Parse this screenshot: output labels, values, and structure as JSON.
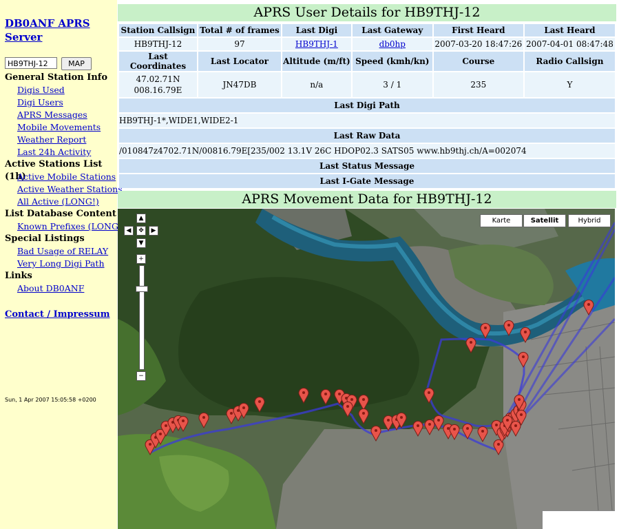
{
  "sidebar": {
    "server_title": "DB0ANF APRS Server",
    "callsign_input": "HB9THJ-12",
    "map_button": "MAP",
    "sections": [
      {
        "heading": "General Station Info",
        "links": [
          "Digis Used",
          "Digi Users",
          "APRS Messages",
          "Mobile Movements",
          "Weather Report",
          "Last 24h Activity"
        ]
      },
      {
        "heading": "Active Stations List (1h)",
        "links": [
          "Active Mobile Stations",
          "Active Weather Stations",
          "All Active (LONG!)"
        ]
      },
      {
        "heading": "List Database Content",
        "links": [
          "Known Prefixes (LONG!)"
        ]
      },
      {
        "heading": "Special Listings",
        "links": [
          "Bad Usage of RELAY",
          "Very Long Digi Path"
        ]
      },
      {
        "heading": "Links",
        "links": [
          "About DB0ANF"
        ]
      }
    ],
    "contact": "Contact / Impressum",
    "timestamp": "Sun, 1 Apr 2007 15:05:58 +0200"
  },
  "details": {
    "title": "APRS User Details for HB9THJ-12",
    "headers1": [
      "Station Callsign",
      "Total # of frames",
      "Last Digi",
      "Last Gateway",
      "First Heard",
      "Last Heard"
    ],
    "values1": [
      "HB9THJ-12",
      "97",
      "HB9THJ-1",
      "db0hp",
      "2007-03-20 18:47:26",
      "2007-04-01 08:47:48"
    ],
    "headers2": [
      "Last Coordinates",
      "Last Locator",
      "Altitude (m/ft)",
      "Speed (kmh/kn)",
      "Course",
      "Radio Callsign"
    ],
    "coord_lat": "47.02.71N",
    "coord_lon": "008.16.79E",
    "values2": [
      "JN47DB",
      "n/a",
      "3 / 1",
      "235",
      "Y"
    ],
    "last_digi_path_label": "Last Digi Path",
    "last_digi_path": "HB9THJ-1*,WIDE1,WIDE2-1",
    "last_raw_label": "Last Raw Data",
    "last_raw": "/010847z4702.71N/00816.79E[235/002 13.1V 26C HDOP02.3 SATS05 www.hb9thj.ch/A=002074",
    "last_status_label": "Last Status Message",
    "last_igate_label": "Last I-Gate Message"
  },
  "movement": {
    "title": "APRS Movement Data for HB9THJ-12",
    "map_types": [
      "Karte",
      "Satellit",
      "Hybrid"
    ],
    "selected_map_type": "Satellit"
  },
  "colors": {
    "sidebar_bg": "#ffffcc",
    "title_bg": "#c8f0c8",
    "header_bg": "#cce0f4",
    "cell_bg": "#eaf4fb",
    "link": "#0000cc",
    "marker": "#e8544a",
    "track": "#3b3bd8"
  }
}
